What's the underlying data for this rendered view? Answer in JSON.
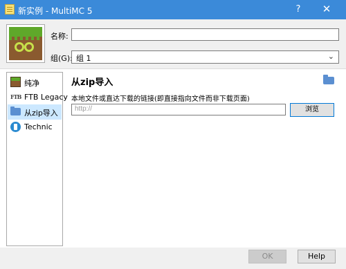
{
  "window": {
    "title": "新实例 - MultiMC 5",
    "help_label": "?",
    "close_label": "✕"
  },
  "form": {
    "name_label": "名称:",
    "name_value": "",
    "group_label": "组(G):",
    "group_value": "组 1"
  },
  "sidebar": {
    "items": [
      {
        "label": "纯净",
        "icon": "grass-block-icon"
      },
      {
        "label": "FTB Legacy",
        "icon": "ftb-logo-icon",
        "icon_text": "FTB"
      },
      {
        "label": "从zip导入",
        "icon": "folder-icon",
        "selected": true
      },
      {
        "label": "Technic",
        "icon": "technic-icon"
      }
    ]
  },
  "import_page": {
    "title": "从zip导入",
    "hint": "本地文件或直达下载的链接(即直接指向文件而非下载页面)",
    "url_placeholder": "http://",
    "url_value": "",
    "browse_label": "浏览"
  },
  "footer": {
    "ok_label": "OK",
    "ok_enabled": false,
    "help_label": "Help"
  },
  "colors": {
    "titlebar": "#3b8ad9",
    "selection": "#cce8ff",
    "accent_border": "#0078d7"
  }
}
